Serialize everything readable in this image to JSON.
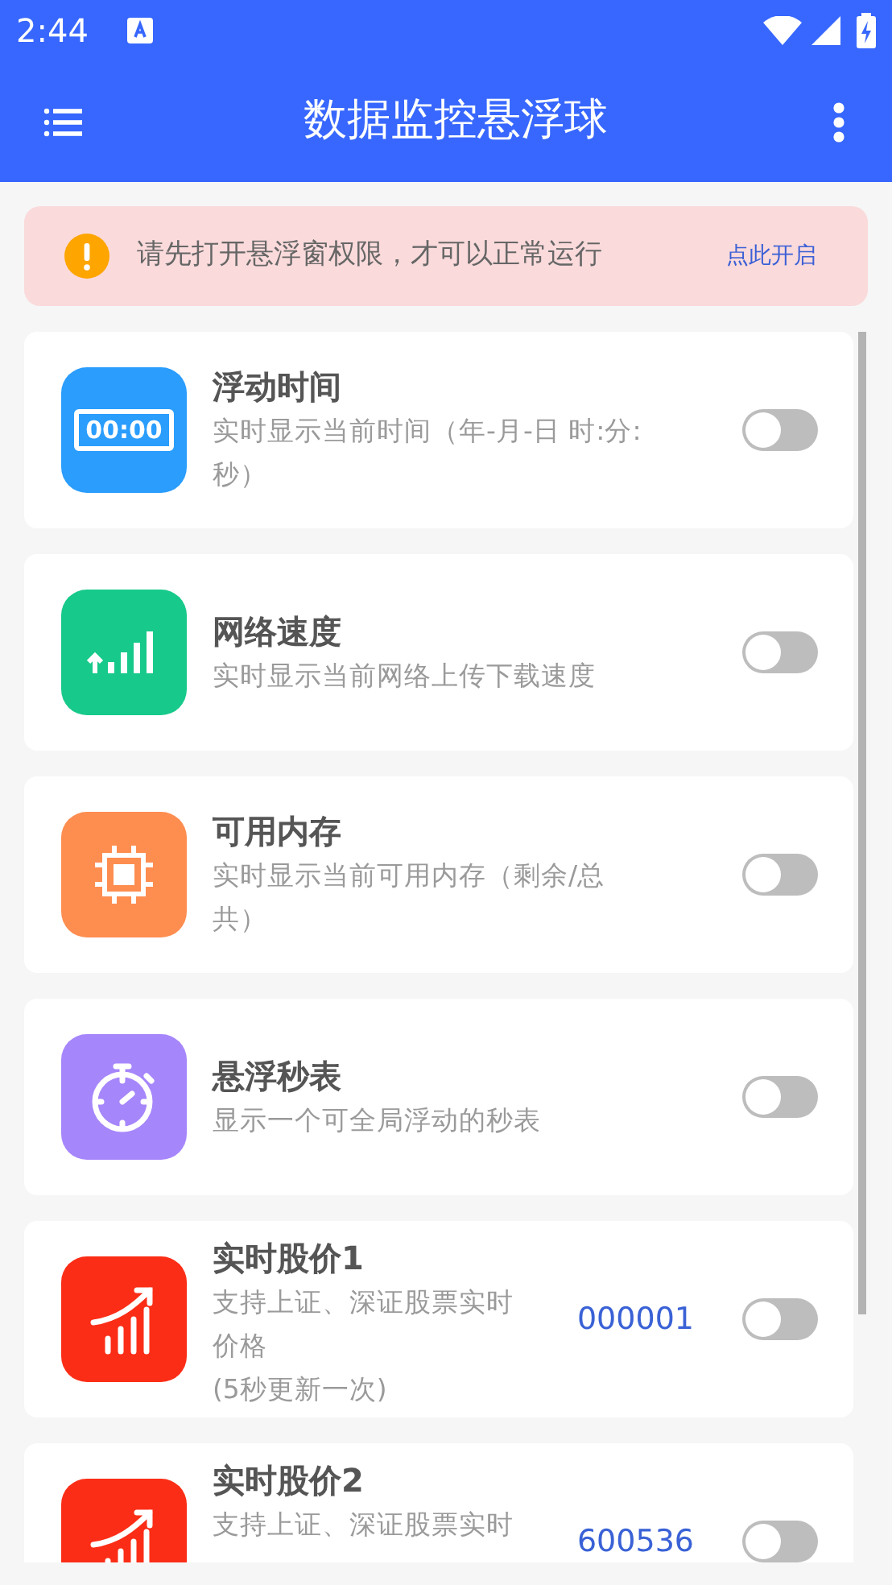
{
  "status_bar": {
    "time": "2:44"
  },
  "app_bar": {
    "title": "数据监控悬浮球"
  },
  "banner": {
    "message": "请先打开悬浮窗权限，才可以正常运行",
    "action": "点此开启"
  },
  "features": [
    {
      "kind": "clock",
      "icon_text": "00:00",
      "color": "#2a9dfd",
      "title": "浮动时间",
      "description": "实时显示当前时间（年-月-日 时:分:秒）",
      "on": false
    },
    {
      "kind": "network",
      "color": "#17c98a",
      "title": "网络速度",
      "description": "实时显示当前网络上传下载速度",
      "on": false
    },
    {
      "kind": "memory",
      "color": "#fe8d50",
      "title": "可用内存",
      "description": "实时显示当前可用内存（剩余/总共）",
      "on": false
    },
    {
      "kind": "stopwatch",
      "color": "#a686fb",
      "title": "悬浮秒表",
      "description": "显示一个可全局浮动的秒表",
      "on": false
    },
    {
      "kind": "stock",
      "color": "#fb2d16",
      "title": "实时股价1",
      "description": "支持上证、深证股票实时价格",
      "note": "(5秒更新一次)",
      "code": "000001",
      "on": false
    },
    {
      "kind": "stock",
      "color": "#fb2d16",
      "title": "实时股价2",
      "description": "支持上证、深证股票实时",
      "code": "600536",
      "on": false
    }
  ]
}
